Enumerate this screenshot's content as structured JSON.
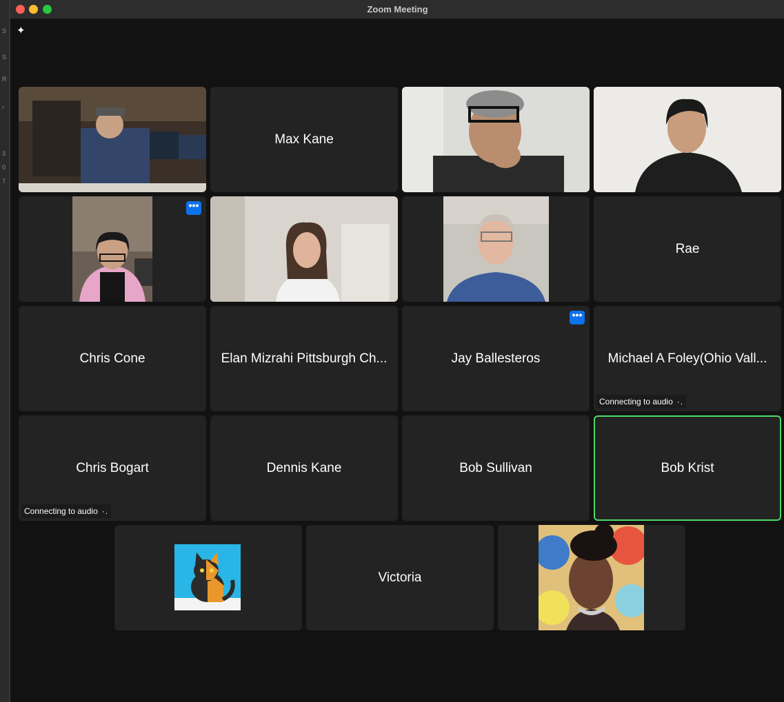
{
  "window": {
    "title": "Zoom Meeting"
  },
  "background_app": {
    "fragments": [
      "S",
      "S",
      "R",
      "›",
      "3",
      "0",
      "7"
    ]
  },
  "participants": [
    {
      "name": "",
      "video": true
    },
    {
      "name": "Max Kane",
      "video": false
    },
    {
      "name": "",
      "video": true
    },
    {
      "name": "",
      "video": true
    },
    {
      "name": "",
      "video": true
    },
    {
      "name": "",
      "video": true
    },
    {
      "name": "",
      "video": true
    },
    {
      "name": "Rae",
      "video": false
    },
    {
      "name": "Chris Cone",
      "video": false
    },
    {
      "name": "Elan Mizrahi Pittsburgh Ch...",
      "video": false
    },
    {
      "name": "Jay Ballesteros",
      "video": false
    },
    {
      "name": "Michael A Foley(Ohio Vall...",
      "video": false,
      "status": "Connecting to audio"
    },
    {
      "name": "Chris Bogart",
      "video": false,
      "status": "Connecting to audio"
    },
    {
      "name": "Dennis Kane",
      "video": false
    },
    {
      "name": "Bob Sullivan",
      "video": false
    },
    {
      "name": "Bob Krist",
      "video": false,
      "active_speaker": true
    },
    {
      "name": "",
      "video": true,
      "avatar": "cat-avatar"
    },
    {
      "name": "Victoria",
      "video": false
    },
    {
      "name": "",
      "video": true,
      "avatar": "portrait-avatar"
    }
  ],
  "more_options_label": "•••",
  "connecting_dots": "·.",
  "colors": {
    "accent": "#0e72ed",
    "active_border": "#4cd964",
    "tile_bg": "#232323"
  }
}
